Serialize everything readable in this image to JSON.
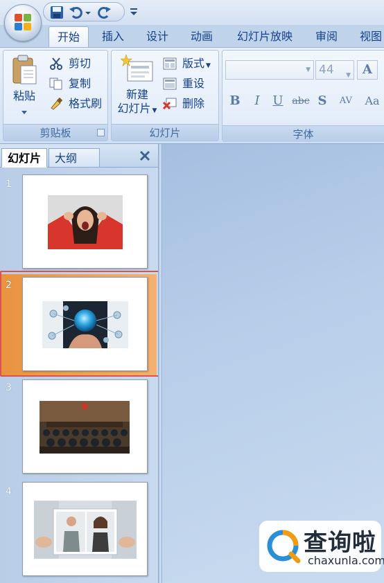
{
  "quick_access": {
    "icons": [
      "office-button",
      "save-icon",
      "undo-icon",
      "dropdown-arrow-icon",
      "redo-icon",
      "customize-qat-icon"
    ]
  },
  "ribbon_tabs": [
    {
      "label": "开始",
      "active": true
    },
    {
      "label": "插入",
      "active": false
    },
    {
      "label": "设计",
      "active": false
    },
    {
      "label": "动画",
      "active": false
    },
    {
      "label": "幻灯片放映",
      "active": false
    },
    {
      "label": "审阅",
      "active": false
    },
    {
      "label": "视图",
      "active": false
    }
  ],
  "clipboard": {
    "paste_label": "粘贴",
    "cut_label": "剪切",
    "copy_label": "复制",
    "format_painter_label": "格式刷",
    "caption": "剪贴板"
  },
  "slides_group": {
    "new_slide_line1": "新建",
    "new_slide_line2": "幻灯片",
    "layout_label": "版式",
    "reset_label": "重设",
    "delete_label": "删除",
    "caption": "幻灯片"
  },
  "font_group": {
    "font_name": "",
    "font_size": "44",
    "bold": "B",
    "italic": "I",
    "underline": "U",
    "strikethrough": "abc",
    "shadow": "S",
    "spacing": "AV",
    "change_case": "Aa",
    "grow": "A",
    "caption": "字体"
  },
  "pane": {
    "tab_slides": "幻灯片",
    "tab_outline": "大纲",
    "close_icon": "close-icon"
  },
  "slides": [
    {
      "number": "1",
      "thumb": "woman screaming holding head",
      "selected": false
    },
    {
      "number": "2",
      "thumb": "hand holding glowing globe network",
      "selected": true
    },
    {
      "number": "3",
      "thumb": "courtroom audience",
      "selected": false
    },
    {
      "number": "4",
      "thumb": "couple photo torn apart",
      "selected": false
    }
  ],
  "watermark": {
    "cn": "查询啦",
    "en": "chaxunla.com"
  },
  "colors": {
    "ribbon_text": "#15428b",
    "selected_slide": "#e9923f",
    "selection_outline": "#d9534f"
  }
}
